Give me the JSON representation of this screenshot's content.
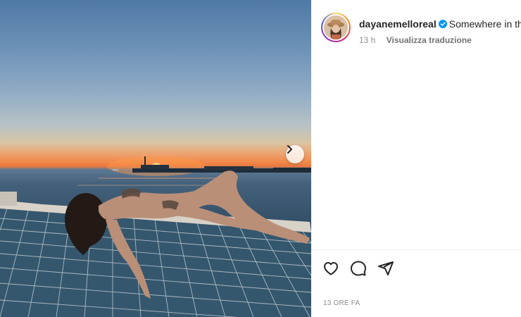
{
  "post": {
    "image_alt": "Woman lying on a catamaran net at sunset over the sea",
    "next_button_icon": "chevron-right-icon"
  },
  "author": {
    "username": "dayanemelloreal",
    "verified_icon": "verified-badge-icon",
    "verified_color": "#0095f6"
  },
  "caption": {
    "text": "Somewhere in the"
  },
  "meta": {
    "time_short": "13 h",
    "translate_label": "Visualizza traduzione"
  },
  "actions": {
    "like_icon": "heart-icon",
    "comment_icon": "comment-icon",
    "share_icon": "paper-plane-icon"
  },
  "footer": {
    "time_ago": "13 ORE FA"
  },
  "colors": {
    "sunset": "#f28a4a",
    "sky_top": "#4f79a6",
    "sea": "#2f4a60"
  }
}
